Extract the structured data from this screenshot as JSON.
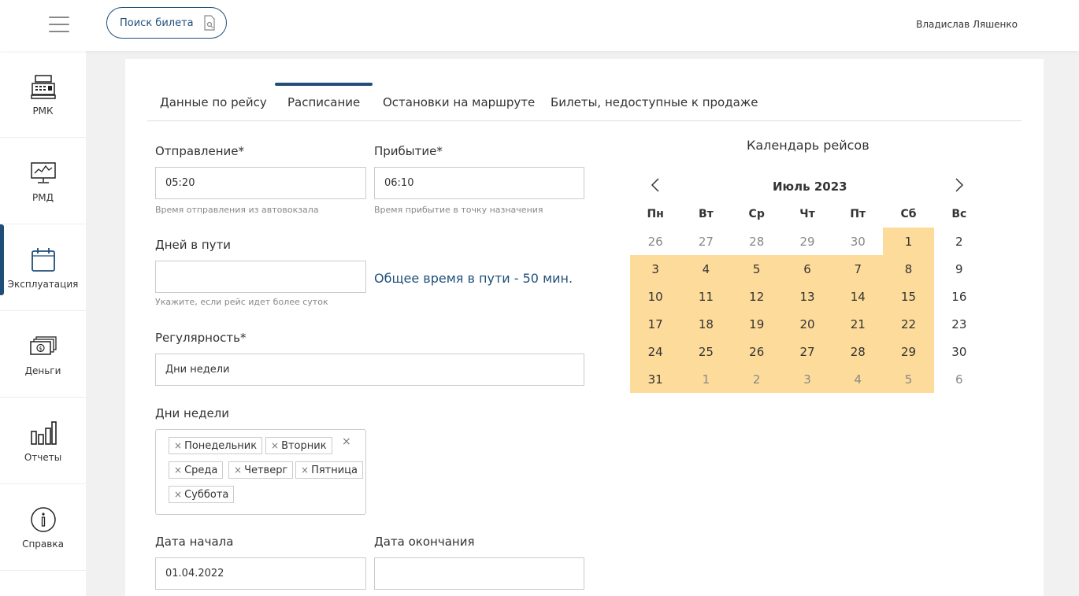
{
  "header": {
    "search_ticket_label": "Поиск билета",
    "user_name": "Владислав Ляшенко"
  },
  "sidebar": {
    "items": [
      {
        "label": "РМК",
        "icon": "cash-register-icon"
      },
      {
        "label": "РМД",
        "icon": "monitor-icon"
      },
      {
        "label": "Эксплуатация",
        "icon": "calendar-icon",
        "active": true
      },
      {
        "label": "Деньги",
        "icon": "money-icon"
      },
      {
        "label": "Отчеты",
        "icon": "bar-chart-icon"
      },
      {
        "label": "Справка",
        "icon": "info-icon"
      }
    ]
  },
  "tabs": [
    {
      "label": "Данные по рейсу"
    },
    {
      "label": "Расписание",
      "active": true
    },
    {
      "label": "Остановки на маршруте"
    },
    {
      "label": "Билеты, недоступные к продаже"
    }
  ],
  "form": {
    "departure": {
      "label": "Отправление*",
      "value": "05:20",
      "hint": "Время отправления из автовокзала"
    },
    "arrival": {
      "label": "Прибытие*",
      "value": "06:10",
      "hint": "Время прибытие в точку назначения"
    },
    "days_in_transit": {
      "label": "Дней в пути",
      "value": "",
      "hint": "Укажите, если рейс идет более суток"
    },
    "total_time_text": "Общее время в пути - 50 мин.",
    "regularity": {
      "label": "Регулярность*",
      "value": "Дни недели"
    },
    "weekdays": {
      "label": "Дни недели",
      "tags": [
        "Понедельник",
        "Вторник",
        "Среда",
        "Четверг",
        "Пятница",
        "Суббота"
      ],
      "tag_remove_symbol": "×",
      "clear_symbol": "×"
    },
    "start_date": {
      "label": "Дата начала",
      "value": "01.04.2022"
    },
    "end_date": {
      "label": "Дата окончания",
      "value": ""
    }
  },
  "calendar": {
    "title": "Календарь рейсов",
    "month_label": "Июль 2023",
    "weekday_headers": [
      "Пн",
      "Вт",
      "Ср",
      "Чт",
      "Пт",
      "Сб",
      "Вс"
    ],
    "weeks": [
      [
        {
          "d": "26",
          "other": true
        },
        {
          "d": "27",
          "other": true
        },
        {
          "d": "28",
          "other": true
        },
        {
          "d": "29",
          "other": true
        },
        {
          "d": "30",
          "other": true
        },
        {
          "d": "1",
          "hl": true
        },
        {
          "d": "2"
        }
      ],
      [
        {
          "d": "3",
          "hl": true
        },
        {
          "d": "4",
          "hl": true
        },
        {
          "d": "5",
          "hl": true
        },
        {
          "d": "6",
          "hl": true
        },
        {
          "d": "7",
          "hl": true
        },
        {
          "d": "8",
          "hl": true
        },
        {
          "d": "9"
        }
      ],
      [
        {
          "d": "10",
          "hl": true
        },
        {
          "d": "11",
          "hl": true
        },
        {
          "d": "12",
          "hl": true
        },
        {
          "d": "13",
          "hl": true
        },
        {
          "d": "14",
          "hl": true
        },
        {
          "d": "15",
          "hl": true
        },
        {
          "d": "16"
        }
      ],
      [
        {
          "d": "17",
          "hl": true
        },
        {
          "d": "18",
          "hl": true
        },
        {
          "d": "19",
          "hl": true
        },
        {
          "d": "20",
          "hl": true
        },
        {
          "d": "21",
          "hl": true
        },
        {
          "d": "22",
          "hl": true
        },
        {
          "d": "23"
        }
      ],
      [
        {
          "d": "24",
          "hl": true
        },
        {
          "d": "25",
          "hl": true
        },
        {
          "d": "26",
          "hl": true
        },
        {
          "d": "27",
          "hl": true
        },
        {
          "d": "28",
          "hl": true
        },
        {
          "d": "29",
          "hl": true
        },
        {
          "d": "30"
        }
      ],
      [
        {
          "d": "31",
          "hl": true
        },
        {
          "d": "1",
          "hl": true,
          "other": true
        },
        {
          "d": "2",
          "hl": true,
          "other": true
        },
        {
          "d": "3",
          "hl": true,
          "other": true
        },
        {
          "d": "4",
          "hl": true,
          "other": true
        },
        {
          "d": "5",
          "hl": true,
          "other": true
        },
        {
          "d": "6",
          "other": true
        }
      ]
    ]
  },
  "colors": {
    "accent": "#1f4e79",
    "highlight": "#fddb9a",
    "background": "#f1f1f1"
  }
}
